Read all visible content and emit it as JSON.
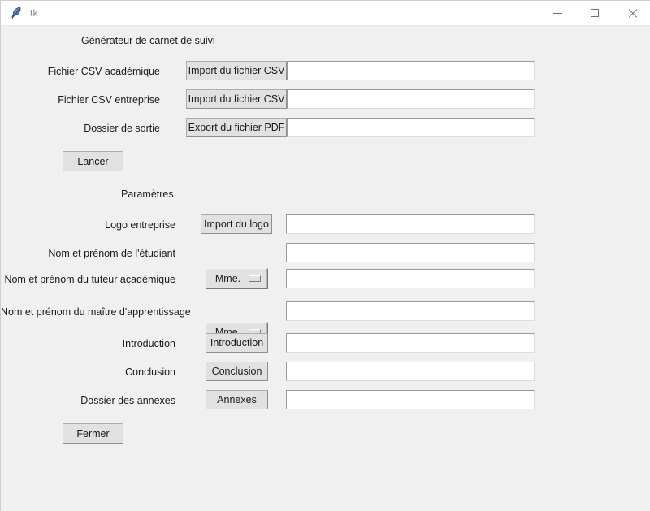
{
  "window": {
    "title": "tk",
    "icon": "feather-icon",
    "background_color": "#f0f0f0",
    "controls": {
      "minimize": "minimize-icon",
      "maximize": "maximize-icon",
      "close": "close-icon"
    }
  },
  "main": {
    "heading_1": "Générateur de carnet de suivi",
    "heading_2": "Paramètres",
    "rows_top": [
      {
        "label": "Fichier CSV académique",
        "button": "Import du fichier CSV",
        "entry_value": "",
        "entry_placeholder": ""
      },
      {
        "label": "Fichier CSV entreprise",
        "button": "Import du fichier CSV",
        "entry_value": "",
        "entry_placeholder": ""
      },
      {
        "label": "Dossier de sortie",
        "button": "Export du fichier PDF",
        "entry_value": "",
        "entry_placeholder": ""
      }
    ],
    "run_button": "Lancer",
    "rows_params": [
      {
        "label": "Logo entreprise",
        "button": "Import du logo",
        "option": null,
        "entry_value": "",
        "entry_placeholder": ""
      },
      {
        "label": "Nom et prénom de l'étudiant",
        "button": null,
        "option": null,
        "entry_value": "",
        "entry_placeholder": ""
      },
      {
        "label": "Nom et prénom du tuteur académique",
        "button": null,
        "option": "Mme.",
        "entry_value": "",
        "entry_placeholder": ""
      },
      {
        "label": "Nom et prénom du maître d'apprentissage",
        "button": null,
        "option": "Mme.",
        "entry_value": "",
        "entry_placeholder": ""
      },
      {
        "label": "Introduction",
        "button": "Introduction",
        "option": null,
        "entry_value": "",
        "entry_placeholder": ""
      },
      {
        "label": "Conclusion",
        "button": "Conclusion",
        "option": null,
        "entry_value": "",
        "entry_placeholder": ""
      },
      {
        "label": "Dossier des annexes",
        "button": "Annexes",
        "option": null,
        "entry_value": "",
        "entry_placeholder": ""
      }
    ],
    "close_button": "Fermer"
  }
}
